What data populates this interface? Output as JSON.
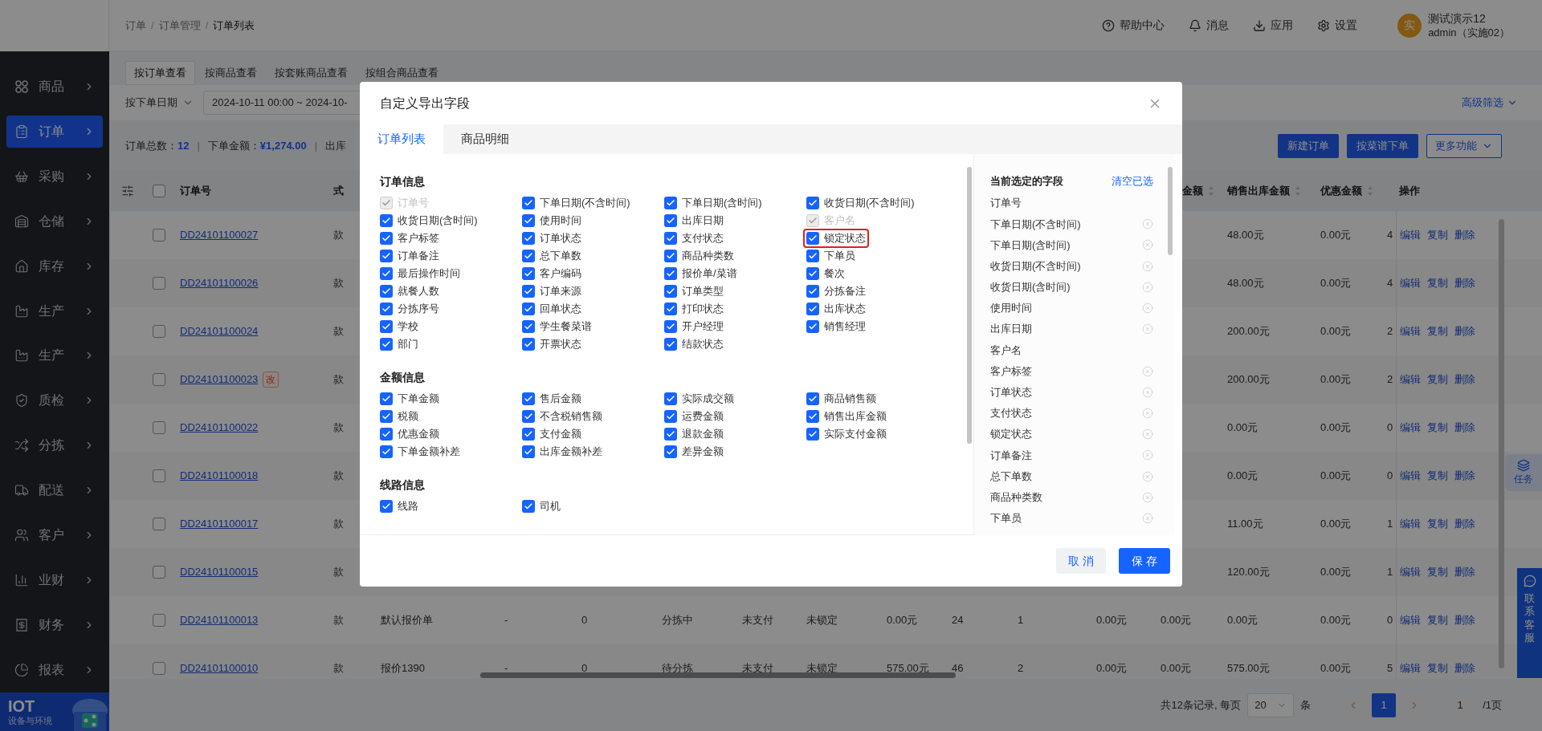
{
  "sidebar": {
    "items": [
      {
        "label": "商品",
        "selected": false
      },
      {
        "label": "订单",
        "selected": true
      },
      {
        "label": "采购",
        "selected": false
      },
      {
        "label": "仓储",
        "selected": false
      },
      {
        "label": "库存",
        "selected": false
      },
      {
        "label": "生产",
        "selected": false
      },
      {
        "label": "生产",
        "selected": false
      },
      {
        "label": "质检",
        "selected": false
      },
      {
        "label": "分拣",
        "selected": false
      },
      {
        "label": "配送",
        "selected": false
      },
      {
        "label": "客户",
        "selected": false
      },
      {
        "label": "业财",
        "selected": false
      },
      {
        "label": "财务",
        "selected": false
      },
      {
        "label": "报表",
        "selected": false
      }
    ],
    "banner": {
      "title": "IOT",
      "subtitle": "设备与环境"
    }
  },
  "header": {
    "breadcrumb": [
      "订单",
      "订单管理",
      "订单列表"
    ],
    "breadcrumb_separator": "/",
    "links": [
      "帮助中心",
      "消息",
      "应用",
      "设置"
    ],
    "user": {
      "avatar": "实",
      "name": "测试演示12",
      "role": "admin（实施02）"
    }
  },
  "view_tabs": [
    {
      "label": "按订单查看",
      "selected": true
    },
    {
      "label": "按商品查看",
      "selected": false
    },
    {
      "label": "按套账商品查看",
      "selected": false
    },
    {
      "label": "按组合商品查看",
      "selected": false
    }
  ],
  "filter": {
    "date_type": "按下单日期",
    "date_range": "2024-10-11 00:00 ~ 2024-10-",
    "advanced": "高级筛选"
  },
  "summary": {
    "separator": "|",
    "items": [
      {
        "label": "订单总数：",
        "value": "12"
      },
      {
        "label": "下单金额：",
        "value": "¥1,274.00"
      },
      {
        "label": "出库"
      }
    ]
  },
  "actions": [
    {
      "label": "新建订单",
      "kind": "primary"
    },
    {
      "label": "按菜谱下单",
      "kind": "primary"
    },
    {
      "label": "更多功能",
      "kind": "dropdown"
    }
  ],
  "table": {
    "select_all_checked": false,
    "actions_header": "操作",
    "columns": [
      {
        "label": "订单号",
        "sortable": false
      },
      {
        "label": "式",
        "sortable": false
      },
      null,
      null,
      null,
      null,
      null,
      null,
      null,
      null,
      null,
      null,
      {
        "label": "金额",
        "sortable": true
      },
      {
        "label": "销售出库金额",
        "sortable": true
      },
      {
        "label": "优惠金额",
        "sortable": true
      },
      null
    ],
    "rows": [
      {
        "checked": false,
        "cells": [
          "DD24101100027",
          "款",
          null,
          null,
          null,
          null,
          null,
          null,
          null,
          null,
          null,
          null,
          null,
          "48.00元",
          "0.00元",
          "4"
        ],
        "actions": [
          "编辑",
          "复制",
          "删除"
        ]
      },
      {
        "checked": false,
        "cells": [
          "DD24101100026",
          "款",
          null,
          null,
          null,
          null,
          null,
          null,
          null,
          null,
          null,
          null,
          null,
          "48.00元",
          "0.00元",
          "4"
        ],
        "actions": [
          "编辑",
          "复制",
          "删除"
        ]
      },
      {
        "checked": false,
        "cells": [
          "DD24101100024",
          "款",
          null,
          null,
          null,
          null,
          null,
          null,
          null,
          null,
          null,
          null,
          null,
          "200.00元",
          "0.00元",
          "2"
        ],
        "actions": [
          "编辑",
          "复制",
          "删除"
        ]
      },
      {
        "checked": false,
        "badge": "改",
        "cells": [
          "DD24101100023",
          "款",
          null,
          null,
          null,
          null,
          null,
          null,
          null,
          null,
          null,
          null,
          null,
          "200.00元",
          "0.00元",
          "2"
        ],
        "actions": [
          "编辑",
          "复制",
          "删除"
        ]
      },
      {
        "checked": false,
        "cells": [
          "DD24101100022",
          "款",
          null,
          null,
          null,
          null,
          null,
          null,
          null,
          null,
          null,
          null,
          null,
          "0.00元",
          "0.00元",
          "0"
        ],
        "actions": [
          "编辑",
          "复制",
          "删除"
        ]
      },
      {
        "checked": false,
        "cells": [
          "DD24101100018",
          "款",
          null,
          null,
          null,
          null,
          null,
          null,
          null,
          null,
          null,
          null,
          null,
          "0.00元",
          "0.00元",
          "0"
        ],
        "actions": [
          "编辑",
          "复制",
          "删除"
        ]
      },
      {
        "checked": false,
        "cells": [
          "DD24101100017",
          "款",
          null,
          null,
          null,
          null,
          null,
          null,
          null,
          null,
          null,
          null,
          null,
          "11.00元",
          "0.00元",
          "1"
        ],
        "actions": [
          "编辑",
          "复制",
          "删除"
        ]
      },
      {
        "checked": false,
        "cells": [
          "DD24101100015",
          "款",
          null,
          null,
          null,
          null,
          null,
          null,
          null,
          null,
          null,
          null,
          null,
          "120.00元",
          "0.00元",
          "1"
        ],
        "actions": [
          "编辑",
          "复制",
          "删除"
        ]
      },
      {
        "checked": false,
        "cells": [
          "DD24101100013",
          "款",
          "默认报价单",
          "-",
          "0",
          "分拣中",
          "未支付",
          "未锁定",
          "0.00元",
          "24",
          "1",
          "0.00元",
          "0.00元",
          "0.00元",
          "0.00元",
          "0"
        ],
        "actions": [
          "编辑",
          "复制",
          "删除"
        ]
      },
      {
        "checked": false,
        "cells": [
          "DD24101100010",
          "款",
          "报价1390",
          "-",
          "0",
          "待分拣",
          "未支付",
          "未锁定",
          "575.00元",
          "46",
          "2",
          "0.00元",
          "0.00元",
          "575.00元",
          "0.00元",
          "5"
        ],
        "actions": [
          "编辑",
          "复制",
          "删除"
        ]
      }
    ]
  },
  "pagination": {
    "summary": "共12条记录, 每页",
    "page_size": "20",
    "unit": "条",
    "pages": [
      {
        "label": "1",
        "selected": true
      }
    ],
    "jump": "1",
    "total_pages": "/1页"
  },
  "side_tabs": [
    {
      "label": "任务"
    },
    {
      "label": "联系客服"
    }
  ],
  "dialog": {
    "title": "自定义导出字段",
    "tabs": [
      {
        "label": "订单列表",
        "selected": true
      },
      {
        "label": "商品明细",
        "selected": false
      }
    ],
    "sections": [
      {
        "title": "订单信息",
        "fields": [
          {
            "label": "订单号",
            "checked": true,
            "disabled": true,
            "highlighted": false
          },
          {
            "label": "下单日期(不含时间)",
            "checked": true,
            "disabled": false,
            "highlighted": false
          },
          {
            "label": "下单日期(含时间)",
            "checked": true,
            "disabled": false,
            "highlighted": false
          },
          {
            "label": "收货日期(不含时间)",
            "checked": true,
            "disabled": false,
            "highlighted": false
          },
          {
            "label": "收货日期(含时间)",
            "checked": true,
            "disabled": false,
            "highlighted": false
          },
          {
            "label": "使用时间",
            "checked": true,
            "disabled": false,
            "highlighted": false
          },
          {
            "label": "出库日期",
            "checked": true,
            "disabled": false,
            "highlighted": false
          },
          {
            "label": "客户名",
            "checked": true,
            "disabled": true,
            "highlighted": false
          },
          {
            "label": "客户标签",
            "checked": true,
            "disabled": false,
            "highlighted": false
          },
          {
            "label": "订单状态",
            "checked": true,
            "disabled": false,
            "highlighted": false
          },
          {
            "label": "支付状态",
            "checked": true,
            "disabled": false,
            "highlighted": false
          },
          {
            "label": "锁定状态",
            "checked": true,
            "disabled": false,
            "highlighted": true
          },
          {
            "label": "订单备注",
            "checked": true,
            "disabled": false,
            "highlighted": false
          },
          {
            "label": "总下单数",
            "checked": true,
            "disabled": false,
            "highlighted": false
          },
          {
            "label": "商品种类数",
            "checked": true,
            "disabled": false,
            "highlighted": false
          },
          {
            "label": "下单员",
            "checked": true,
            "disabled": false,
            "highlighted": false
          },
          {
            "label": "最后操作时间",
            "checked": true,
            "disabled": false,
            "highlighted": false
          },
          {
            "label": "客户编码",
            "checked": true,
            "disabled": false,
            "highlighted": false
          },
          {
            "label": "报价单/菜谱",
            "checked": true,
            "disabled": false,
            "highlighted": false
          },
          {
            "label": "餐次",
            "checked": true,
            "disabled": false,
            "highlighted": false
          },
          {
            "label": "就餐人数",
            "checked": true,
            "disabled": false,
            "highlighted": false
          },
          {
            "label": "订单来源",
            "checked": true,
            "disabled": false,
            "highlighted": false
          },
          {
            "label": "订单类型",
            "checked": true,
            "disabled": false,
            "highlighted": false
          },
          {
            "label": "分拣备注",
            "checked": true,
            "disabled": false,
            "highlighted": false
          },
          {
            "label": "分拣序号",
            "checked": true,
            "disabled": false,
            "highlighted": false
          },
          {
            "label": "回单状态",
            "checked": true,
            "disabled": false,
            "highlighted": false
          },
          {
            "label": "打印状态",
            "checked": true,
            "disabled": false,
            "highlighted": false
          },
          {
            "label": "出库状态",
            "checked": true,
            "disabled": false,
            "highlighted": false
          },
          {
            "label": "学校",
            "checked": true,
            "disabled": false,
            "highlighted": false
          },
          {
            "label": "学生餐菜谱",
            "checked": true,
            "disabled": false,
            "highlighted": false
          },
          {
            "label": "开户经理",
            "checked": true,
            "disabled": false,
            "highlighted": false
          },
          {
            "label": "销售经理",
            "checked": true,
            "disabled": false,
            "highlighted": false
          },
          {
            "label": "部门",
            "checked": true,
            "disabled": false,
            "highlighted": false
          },
          {
            "label": "开票状态",
            "checked": true,
            "disabled": false,
            "highlighted": false
          },
          {
            "label": "结款状态",
            "checked": true,
            "disabled": false,
            "highlighted": false
          }
        ]
      },
      {
        "title": "金额信息",
        "fields": [
          {
            "label": "下单金额",
            "checked": true,
            "disabled": false,
            "highlighted": false
          },
          {
            "label": "售后金额",
            "checked": true,
            "disabled": false,
            "highlighted": false
          },
          {
            "label": "实际成交额",
            "checked": true,
            "disabled": false,
            "highlighted": false
          },
          {
            "label": "商品销售额",
            "checked": true,
            "disabled": false,
            "highlighted": false
          },
          {
            "label": "税额",
            "checked": true,
            "disabled": false,
            "highlighted": false
          },
          {
            "label": "不含税销售额",
            "checked": true,
            "disabled": false,
            "highlighted": false
          },
          {
            "label": "运费金额",
            "checked": true,
            "disabled": false,
            "highlighted": false
          },
          {
            "label": "销售出库金额",
            "checked": true,
            "disabled": false,
            "highlighted": false
          },
          {
            "label": "优惠金额",
            "checked": true,
            "disabled": false,
            "highlighted": false
          },
          {
            "label": "支付金额",
            "checked": true,
            "disabled": false,
            "highlighted": false
          },
          {
            "label": "退款金额",
            "checked": true,
            "disabled": false,
            "highlighted": false
          },
          {
            "label": "实际支付金额",
            "checked": true,
            "disabled": false,
            "highlighted": false
          },
          {
            "label": "下单金额补差",
            "checked": true,
            "disabled": false,
            "highlighted": false
          },
          {
            "label": "出库金额补差",
            "checked": true,
            "disabled": false,
            "highlighted": false
          },
          {
            "label": "差异金额",
            "checked": true,
            "disabled": false,
            "highlighted": false
          }
        ]
      },
      {
        "title": "线路信息",
        "fields": [
          {
            "label": "线路",
            "checked": true,
            "disabled": false,
            "highlighted": false
          },
          {
            "label": "司机",
            "checked": true,
            "disabled": false,
            "highlighted": false
          }
        ]
      }
    ],
    "selected_panel": {
      "title": "当前选定的字段",
      "clear": "清空已选",
      "items": [
        {
          "label": "订单号",
          "removable": false
        },
        {
          "label": "下单日期(不含时间)",
          "removable": true
        },
        {
          "label": "下单日期(含时间)",
          "removable": true
        },
        {
          "label": "收货日期(不含时间)",
          "removable": true
        },
        {
          "label": "收货日期(含时间)",
          "removable": true
        },
        {
          "label": "使用时间",
          "removable": true
        },
        {
          "label": "出库日期",
          "removable": true
        },
        {
          "label": "客户名",
          "removable": false
        },
        {
          "label": "客户标签",
          "removable": true
        },
        {
          "label": "订单状态",
          "removable": true
        },
        {
          "label": "支付状态",
          "removable": true
        },
        {
          "label": "锁定状态",
          "removable": true
        },
        {
          "label": "订单备注",
          "removable": true
        },
        {
          "label": "总下单数",
          "removable": true
        },
        {
          "label": "商品种类数",
          "removable": true
        },
        {
          "label": "下单员",
          "removable": true
        }
      ]
    },
    "buttons": [
      {
        "label": "取 消",
        "kind": "secondary"
      },
      {
        "label": "保 存",
        "kind": "primary"
      }
    ]
  }
}
